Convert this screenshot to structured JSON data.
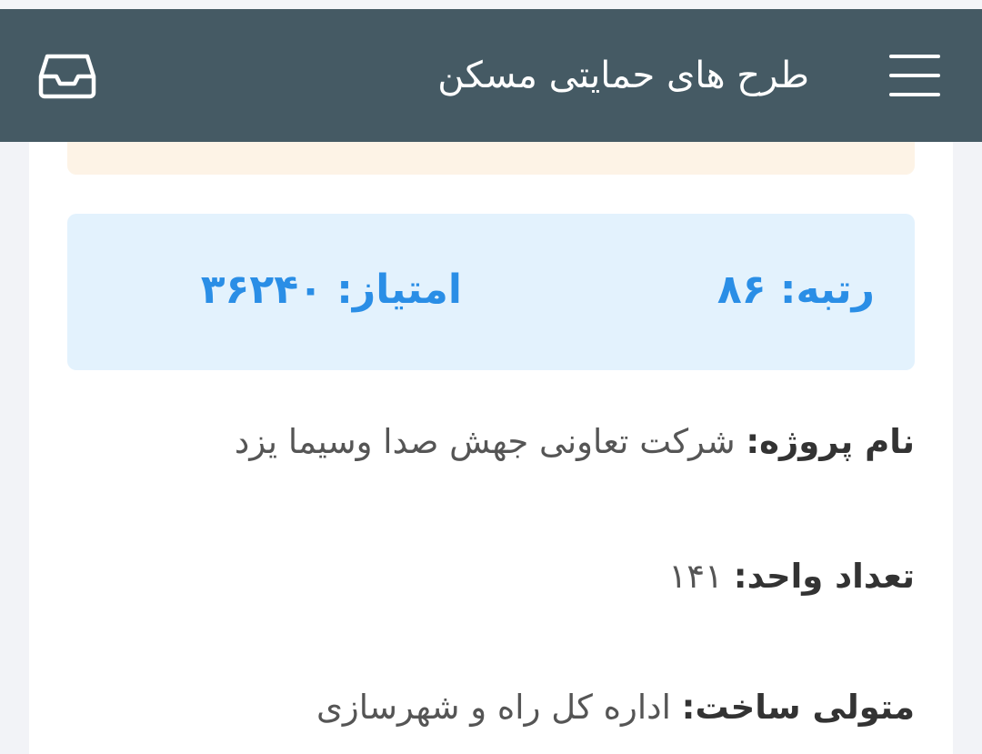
{
  "header": {
    "title": "طرح های حمایتی مسکن",
    "menu_icon": "hamburger-menu-icon",
    "inbox_icon": "inbox-tray-icon",
    "background": "#455a64"
  },
  "score_box": {
    "rank_label": "رتبه:",
    "rank_value": "۸۶",
    "points_label": "امتیاز:",
    "points_value": "۳۶۲۴۰",
    "accent": "#2a8ee6"
  },
  "details": [
    {
      "label": "نام پروژه:",
      "value": "شرکت تعاونی جهش صدا وسیما یزد"
    },
    {
      "label": "تعداد واحد:",
      "value": "۱۴۱"
    },
    {
      "label": "متولی ساخت:",
      "value": "اداره کل راه و شهرسازی"
    }
  ]
}
